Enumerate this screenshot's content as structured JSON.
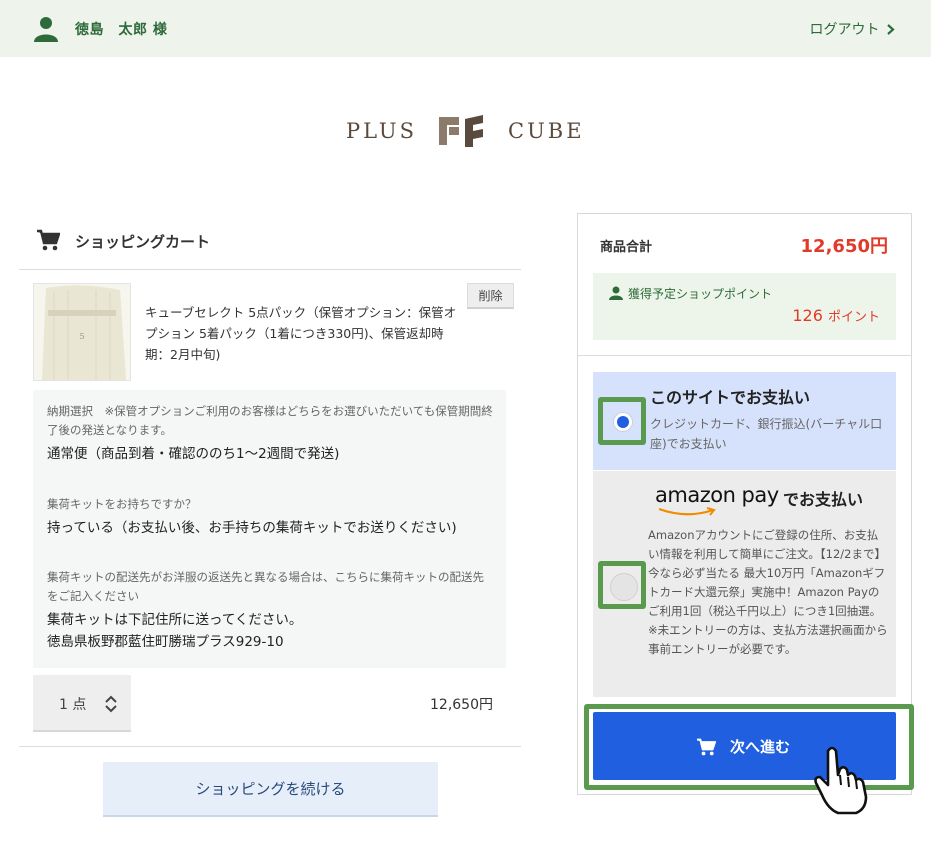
{
  "header": {
    "user_name": "徳島　太郎 様",
    "logout_label": "ログアウト",
    "user_icon": "user-icon",
    "chevron_icon": "chevron-right-icon"
  },
  "logo": {
    "left_text": "PLUS",
    "right_text": "CUBE"
  },
  "cart": {
    "title": "ショッピングカート",
    "icon": "cart-icon",
    "item": {
      "name": "キューブセレクト 5点パック（保管オプション：保管オプション 5着パック（1着につき330円)、保管返却時期：2月中旬)",
      "delete_label": "削除",
      "thumb_text": "5"
    },
    "options": [
      {
        "question": "納期選択　※保管オプションご利用のお客様はどちらをお選びいただいても保管期間終了後の発送となります。",
        "answer": "通常便（商品到着・確認ののち1〜2週間で発送)"
      },
      {
        "question": "集荷キットをお持ちですか？",
        "answer": "持っている（お支払い後、お手持ちの集荷キットでお送りください)"
      },
      {
        "question": "集荷キットの配送先がお洋服の返送先と異なる場合は、こちらに集荷キットの配送先をご記入ください",
        "answer": "集荷キットは下記住所に送ってください。",
        "answer2": "徳島県板野郡藍住町勝瑞プラス929-10"
      }
    ],
    "quantity": "1 点",
    "price": "12,650円",
    "continue_label": "ショッピングを続ける"
  },
  "summary": {
    "subtotal_label": "商品合計",
    "subtotal_value": "12,650円",
    "points_label": "獲得予定ショップポイント",
    "points_value": "126",
    "points_unit": "ポイント",
    "payment_site": {
      "title": "このサイトでお支払い",
      "desc": "クレジットカード、銀行振込(バーチャル口座)でお支払い",
      "selected": true
    },
    "payment_amazon": {
      "logo_text": "amazon pay",
      "title": "でお支払い",
      "desc": "Amazonアカウントにご登録の住所、お支払い情報を利用して簡単にご注文。【12/2まで】今なら必ず当たる 最大10万円「Amazonギフトカード大還元祭」実施中！Amazon Payのご利用1回（税込千円以上）につき1回抽選。※未エントリーの方は、支払方法選択画面から事前エントリーが必要です。",
      "selected": false
    },
    "next_label": "次へ進む",
    "next_icon": "cart-icon"
  },
  "colors": {
    "green": "#2e6b3a",
    "highlight": "#5a9a4e",
    "blue": "#1f5fe0",
    "red": "#e03a2a"
  }
}
